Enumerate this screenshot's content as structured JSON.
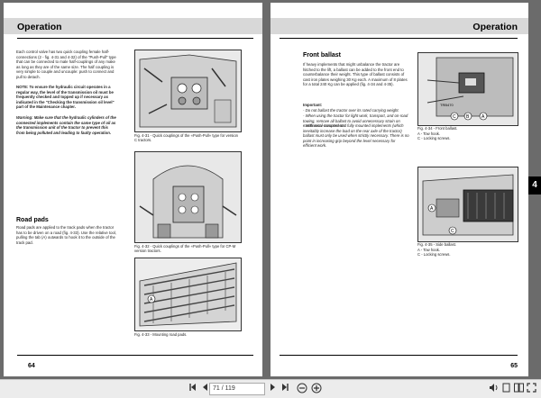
{
  "left_page": {
    "header": "Operation",
    "paragraphs": {
      "p1": "Each control valve has two quick coupling female half-connections (2 - fig. 4-31 and 4-32) of the \"Push-Pull\" type that can be connected to male half-couplings of any make as long as they are of the same size. The half coupling is very simple to couple and uncouple: push to connect and pull to detach.",
      "note": "NOTE: To ensure the hydraulic circuit operates in a regular way, the level of the transmission oil must be frequently checked and topped up if necessary as indicated in the \"Checking the transmission oil level\" part of the Maintenance chapter.",
      "warning": "Warning: Make sure that the hydraulic cylinders of the connected implements contain the same type of oil as the transmission unit of the tractor to prevent this from being polluted and leading to faulty operation."
    },
    "section_road_pads": "Road pads",
    "road_pads_text": "Road pads are applied to the track pads when the tractor has to be driven on a road (fig. 4-33). Use the relative tool, pulling the tab (A) outwards to hook it to the outside of the track pad.",
    "captions": {
      "fig31": "Fig. 4-31 - Quick couplings of the «Push-Pull» type for version C tractors.",
      "fig32": "Fig. 4-32 - Quick couplings of the «Push-Pull» type for CP-M version tractors.",
      "fig33": "Fig. 4-33 - Mounting road pads."
    },
    "page_number": "64"
  },
  "right_page": {
    "header": "Operation",
    "section_front_ballast": "Front ballast",
    "ballast_text": "If heavy implements that might unbalance the tractor are hitched to the lift, a ballast can be added to the front end to counterbalance their weight. This type of ballast consists of cast iron plates weighing 30 Kg each. A maximum of 8 plates for a total 240 Kg can be applied (fig. 4-34 and 4-35).",
    "important_label": "Important:",
    "important_items": [
      "- Do not ballast the tractor over its rated carrying weight.",
      "- When using the tractor for light work, transport, and on-road towing, remove all ballast to avoid unnecessary strain on mechanical components.",
      "- With semi-mounted and fully mounted implements (which inevitably increase the load on the rear axle of the tractor) ballast must only be used when strictly necessary. There is no point in increasing grip beyond the level necessary for efficient work."
    ],
    "captions": {
      "fig34": "Fig. 4-34 - Front ballast.",
      "fig34_a": "A  -  Tow hook.",
      "fig34_c": "C  -  Locking screws.",
      "fig35": "Fig. 4-35 - Side ballast.",
      "fig35_a": "A  -  Tow hook.",
      "fig35_c": "C  -  Locking screws."
    },
    "fig34_code": "TRB470",
    "page_number": "65",
    "side_tab": "4"
  },
  "toolbar": {
    "page_input": "71 / 119"
  },
  "colors": {
    "viewer_background": "#6b6b6b",
    "page_background": "#ffffff",
    "header_band": "#d8d8d8",
    "toolbar": "#ececec"
  }
}
